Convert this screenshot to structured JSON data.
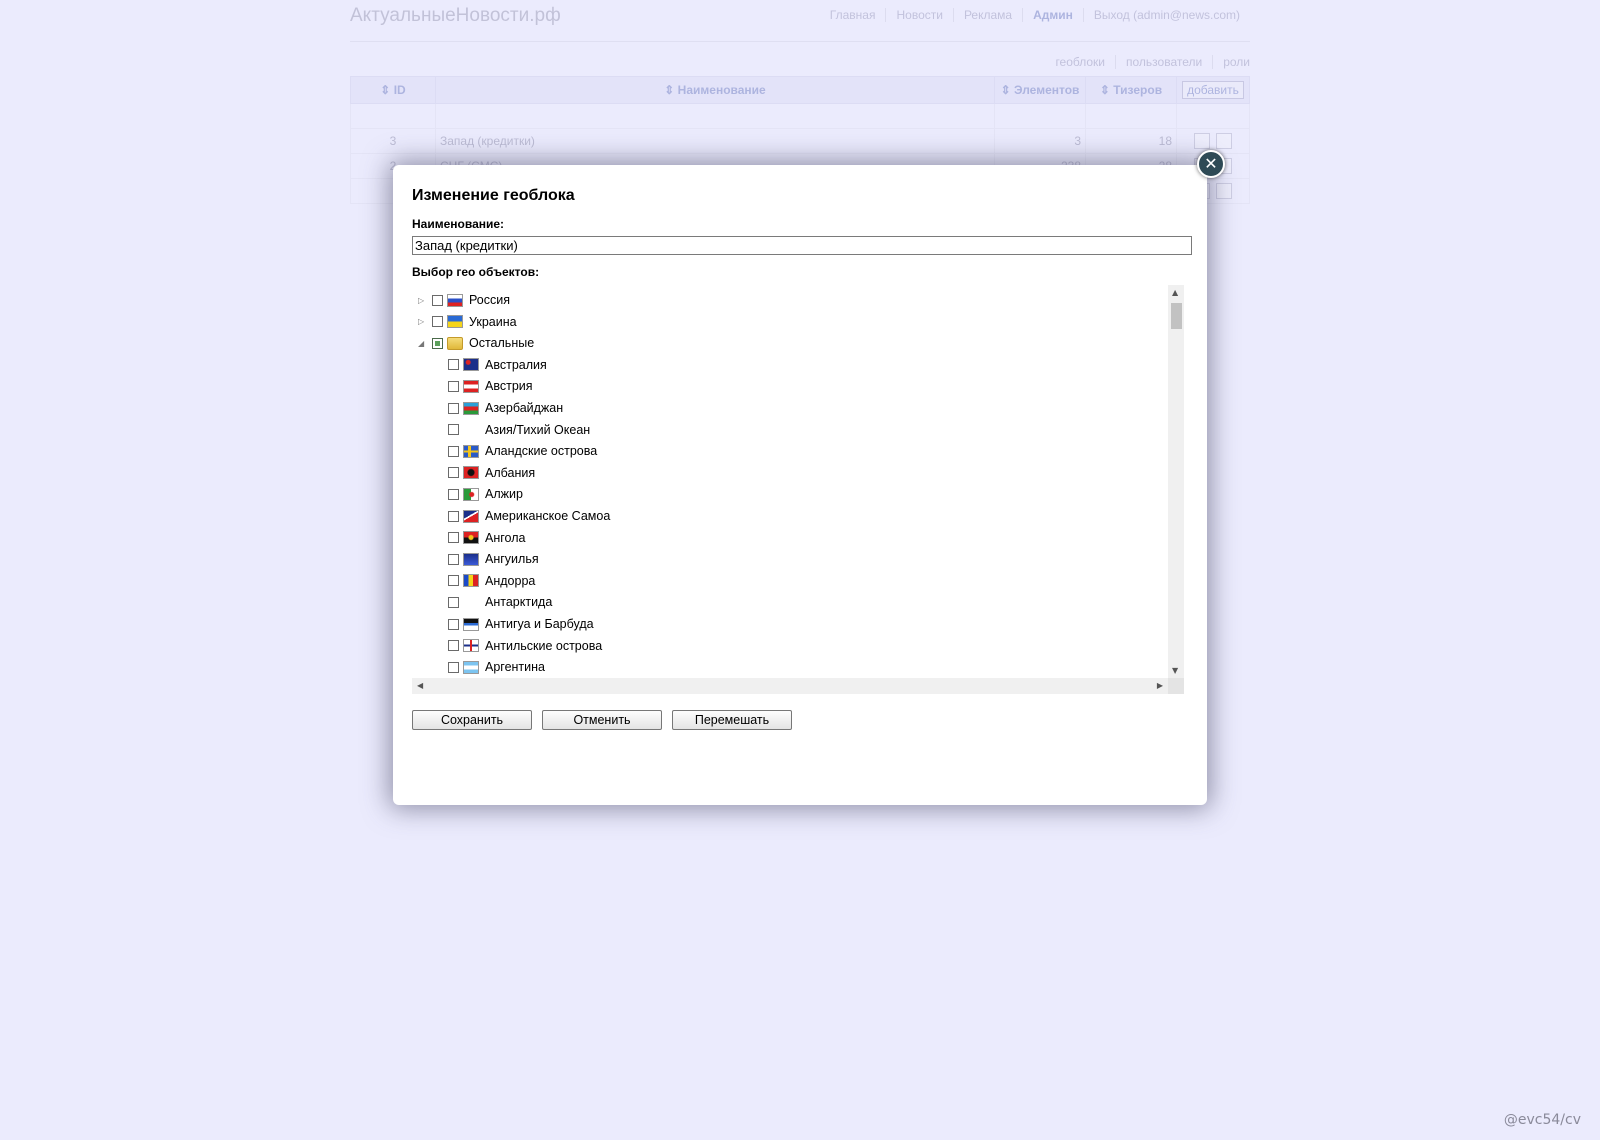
{
  "site": {
    "brand": "АктуальныеНовости.рф",
    "nav": [
      "Главная",
      "Новости",
      "Реклама",
      "Админ",
      "Выход (admin@news.com)"
    ],
    "active_nav": "Админ",
    "subnav": [
      "геоблоки",
      "пользователи",
      "роли"
    ]
  },
  "table": {
    "headers": {
      "id": "ID",
      "name": "Наименование",
      "elements": "Элементов",
      "teasers": "Тизеров"
    },
    "add_button": "добавить",
    "rows": [
      {
        "id": "3",
        "name": "Запад (кредитки)",
        "elements": "3",
        "teasers": "18"
      },
      {
        "id": "2",
        "name": "СНГ (СМС)",
        "elements": "238",
        "teasers": "28"
      }
    ]
  },
  "modal": {
    "title": "Изменение геоблока",
    "name_label": "Наименование:",
    "name_value": "Запад (кредитки)",
    "geo_label": "Выбор гео объектов:",
    "close_symbol": "✕",
    "tree": [
      {
        "label": "Россия",
        "level": 0,
        "expander": "collapsed",
        "checkbox": "unchecked",
        "icon": "flag-russia"
      },
      {
        "label": "Украина",
        "level": 0,
        "expander": "collapsed",
        "checkbox": "unchecked",
        "icon": "flag-ukraine"
      },
      {
        "label": "Остальные",
        "level": 0,
        "expander": "expanded",
        "checkbox": "partial",
        "icon": "folder"
      },
      {
        "label": "Австралия",
        "level": 1,
        "checkbox": "unchecked",
        "icon": "flag-australia"
      },
      {
        "label": "Австрия",
        "level": 1,
        "checkbox": "unchecked",
        "icon": "flag-austria"
      },
      {
        "label": "Азербайджан",
        "level": 1,
        "checkbox": "unchecked",
        "icon": "flag-azerbaijan"
      },
      {
        "label": "Азия/Тихий Океан",
        "level": 1,
        "checkbox": "unchecked",
        "icon": "none"
      },
      {
        "label": "Аландские острова",
        "level": 1,
        "checkbox": "unchecked",
        "icon": "flag-aland"
      },
      {
        "label": "Албания",
        "level": 1,
        "checkbox": "unchecked",
        "icon": "flag-albania"
      },
      {
        "label": "Алжир",
        "level": 1,
        "checkbox": "unchecked",
        "icon": "flag-algeria"
      },
      {
        "label": "Американское Самоа",
        "level": 1,
        "checkbox": "unchecked",
        "icon": "flag-american-samoa"
      },
      {
        "label": "Ангола",
        "level": 1,
        "checkbox": "unchecked",
        "icon": "flag-angola"
      },
      {
        "label": "Ангуилья",
        "level": 1,
        "checkbox": "unchecked",
        "icon": "flag-anguilla"
      },
      {
        "label": "Андорра",
        "level": 1,
        "checkbox": "unchecked",
        "icon": "flag-andorra"
      },
      {
        "label": "Антарктида",
        "level": 1,
        "checkbox": "unchecked",
        "icon": "none"
      },
      {
        "label": "Антигуа и Барбуда",
        "level": 1,
        "checkbox": "unchecked",
        "icon": "flag-antigua"
      },
      {
        "label": "Антильские острова",
        "level": 1,
        "checkbox": "unchecked",
        "icon": "flag-antilles"
      },
      {
        "label": "Аргентина",
        "level": 1,
        "checkbox": "unchecked",
        "icon": "flag-argentina"
      }
    ],
    "buttons": {
      "save": "Сохранить",
      "cancel": "Отменить",
      "shuffle": "Перемешать"
    }
  },
  "watermark": "@evc54/cv",
  "colors": {
    "page_bg": "#ebebfd",
    "modal_bg": "#ffffff",
    "close_btn": "#2e4a55",
    "header_accent": "#5a6ab8"
  }
}
